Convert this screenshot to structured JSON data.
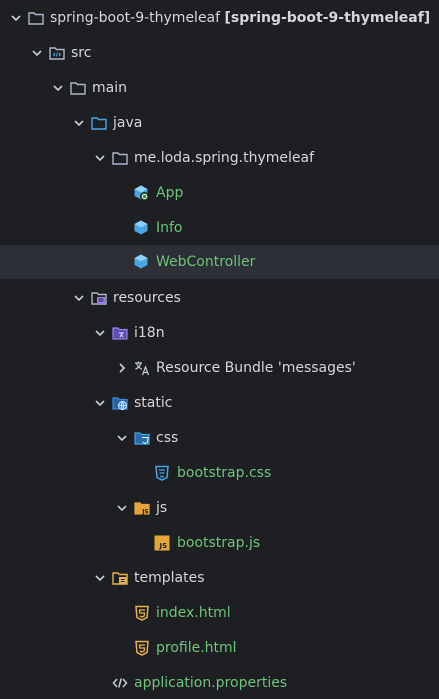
{
  "colors": {
    "background": "#1e1f22",
    "selected_row": "#2c2f35",
    "text": "#d4d6dc",
    "file_text_green": "#6ec27a",
    "folder_outline": "#aeb6c8",
    "java_class_blue": "#4aa5e0",
    "resources_purple": "#9a7ee6",
    "static_blue": "#3e8be0",
    "css_blue": "#3fa6e6",
    "js_yellow": "#e6a53b",
    "html_orange": "#e2b050",
    "templates_yellow": "#e2b050"
  },
  "tree": [
    {
      "label": "spring-boot-9-thymeleaf",
      "suffix": "[spring-boot-9-thymeleaf]",
      "icon": "folder-icon",
      "chevron": "down"
    },
    {
      "label": "src",
      "icon": "source-folder-icon",
      "chevron": "down"
    },
    {
      "label": "main",
      "icon": "folder-icon",
      "chevron": "down"
    },
    {
      "label": "java",
      "icon": "source-folder-icon",
      "chevron": "down"
    },
    {
      "label": "me.loda.spring.thymeleaf",
      "icon": "package-folder-icon",
      "chevron": "down"
    },
    {
      "label": "App",
      "icon": "spring-class-icon",
      "chevron": "none",
      "green": true
    },
    {
      "label": "Info",
      "icon": "java-class-icon",
      "chevron": "none",
      "green": true
    },
    {
      "label": "WebController",
      "icon": "java-class-icon",
      "chevron": "none",
      "green": true,
      "selected": true
    },
    {
      "label": "resources",
      "icon": "resources-folder-icon",
      "chevron": "down"
    },
    {
      "label": "i18n",
      "icon": "i18n-folder-icon",
      "chevron": "down"
    },
    {
      "label": "Resource Bundle 'messages'",
      "icon": "resource-bundle-icon",
      "chevron": "right"
    },
    {
      "label": "static",
      "icon": "web-folder-icon",
      "chevron": "down"
    },
    {
      "label": "css",
      "icon": "css-folder-icon",
      "chevron": "down"
    },
    {
      "label": "bootstrap.css",
      "icon": "css-file-icon",
      "chevron": "none",
      "green": true
    },
    {
      "label": "js",
      "icon": "js-folder-icon",
      "chevron": "down"
    },
    {
      "label": "bootstrap.js",
      "icon": "js-file-icon",
      "chevron": "none",
      "green": true
    },
    {
      "label": "templates",
      "icon": "templates-folder-icon",
      "chevron": "down"
    },
    {
      "label": "index.html",
      "icon": "html-file-icon",
      "chevron": "none",
      "green": true
    },
    {
      "label": "profile.html",
      "icon": "html-file-icon",
      "chevron": "none",
      "green": true
    },
    {
      "label": "application.properties",
      "icon": "properties-file-icon",
      "chevron": "none",
      "green": true
    }
  ]
}
